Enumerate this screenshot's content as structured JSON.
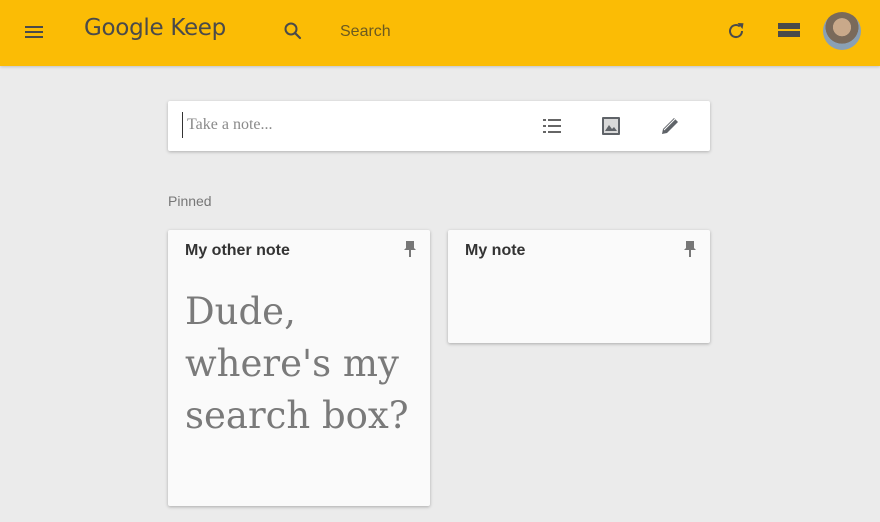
{
  "app": {
    "logo": "Google Keep"
  },
  "header": {
    "search": {
      "placeholder": "Search",
      "value": ""
    },
    "icons": [
      "menu-icon",
      "search-icon",
      "refresh-icon",
      "list-view-icon",
      "avatar"
    ]
  },
  "compose": {
    "placeholder": "Take a note...",
    "icons": [
      "checklist-icon",
      "image-icon",
      "pencil-icon"
    ]
  },
  "sections": {
    "pinned_label": "Pinned"
  },
  "notes": [
    {
      "title": "My other note",
      "body": "Dude, where's my search box?",
      "pinned": true
    },
    {
      "title": "My note",
      "body": "",
      "pinned": true
    }
  ],
  "colors": {
    "header": "#fbbc05",
    "background": "#ebebeb",
    "card": "#fafafa"
  }
}
